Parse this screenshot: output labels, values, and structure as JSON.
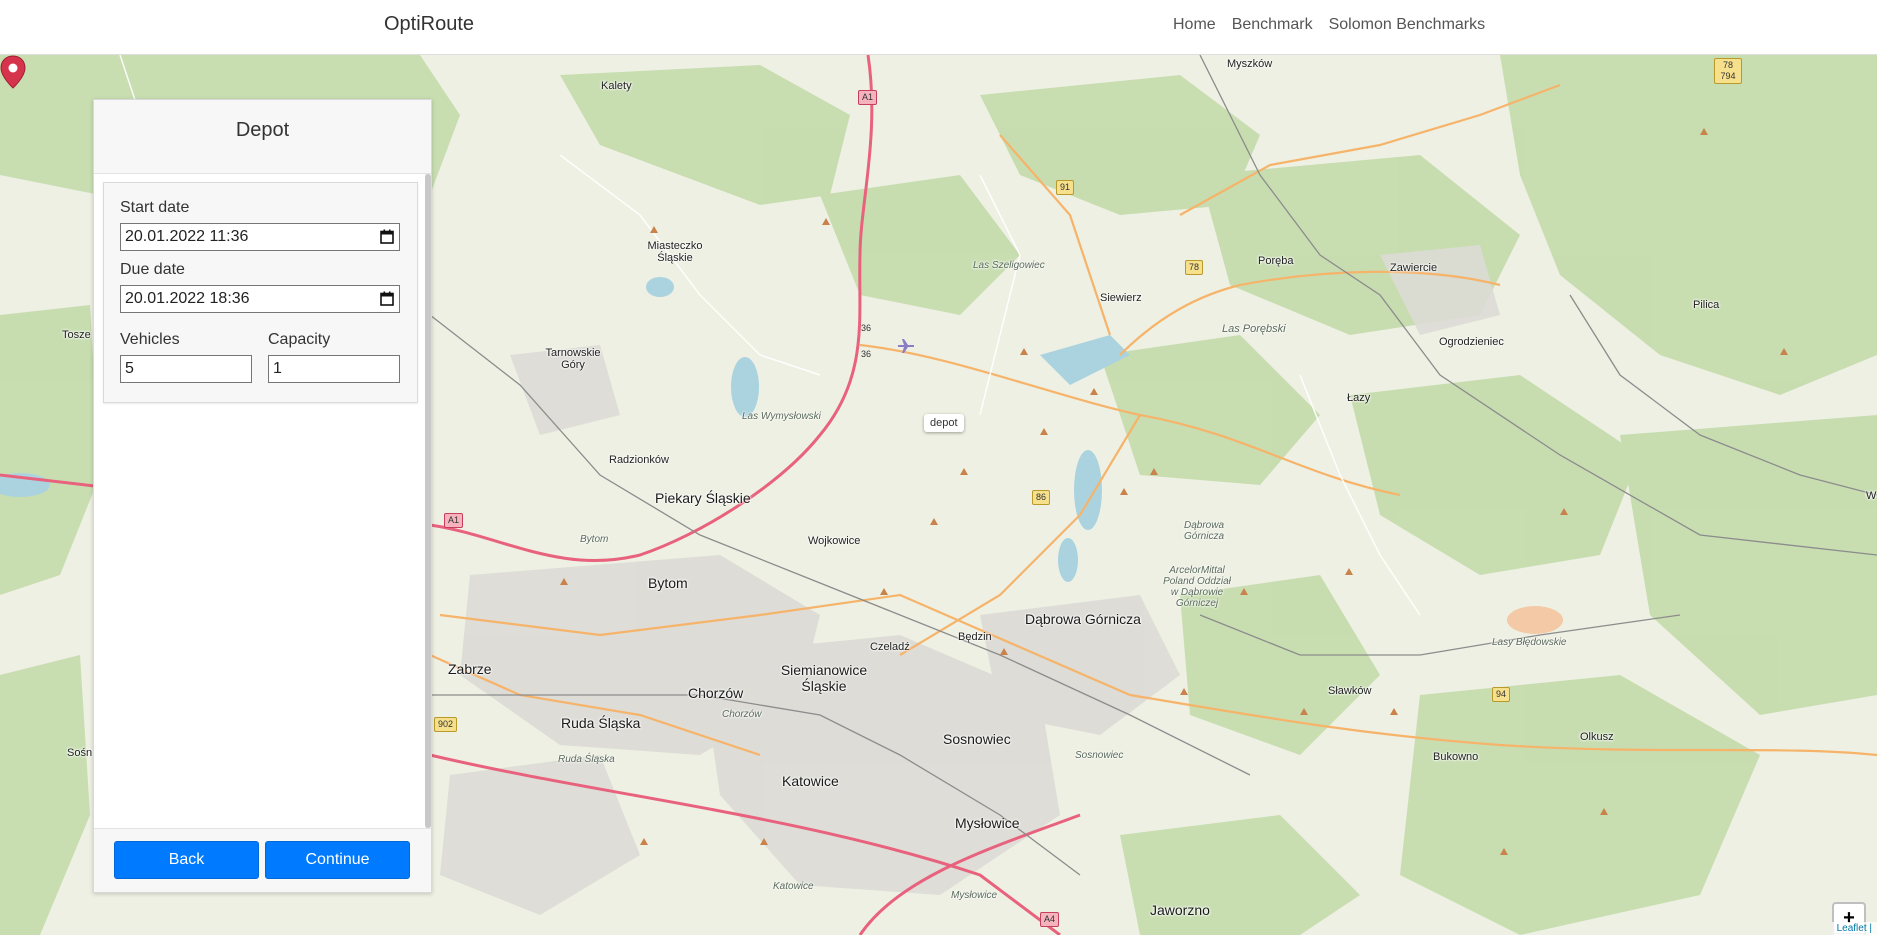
{
  "navbar": {
    "brand": "OptiRoute",
    "links": [
      "Home",
      "Benchmark",
      "Solomon Benchmarks"
    ]
  },
  "panel": {
    "title": "Depot",
    "start_date_label": "Start date",
    "start_date_value": "20.01.2022 11:36",
    "due_date_label": "Due date",
    "due_date_value": "20.01.2022 18:36",
    "vehicles_label": "Vehicles",
    "vehicles_value": "5",
    "capacity_label": "Capacity",
    "capacity_value": "1",
    "back_label": "Back",
    "continue_label": "Continue"
  },
  "map": {
    "marker_label": "depot",
    "zoom_in": "+",
    "zoom_out": "−",
    "attribution": "Leaflet |",
    "places": [
      "Myszków",
      "Kalety",
      "Miasteczko Śląskie",
      "Tarnowskie Góry",
      "Siewierz",
      "Poręba",
      "Zawiercie",
      "Pilica",
      "Ogrodzieniec",
      "Łazy",
      "Radzionków",
      "Piekary Śląskie",
      "Wojkowice",
      "Bytom",
      "Będzin",
      "Czeladź",
      "Dąbrowa Górnicza",
      "Zabrze",
      "Siemianowice Śląskie",
      "Chorzów",
      "Ruda Śląska",
      "Katowice",
      "Sosnowiec",
      "Mysłowice",
      "Jaworzno",
      "Sławków",
      "Bukowno",
      "Olkusz",
      "Tosze",
      "Sośn",
      "W"
    ],
    "italic_places": [
      "Las Szeligowiec",
      "Las Porębski",
      "Las Wymysłowski",
      "Dąbrowa Górnicza",
      "ArcelorMittal Poland Oddział w Dąbrowie Górniczej",
      "Bytom",
      "Chorzów",
      "Ruda Śląska",
      "Sosnowiec",
      "Katowice",
      "Mysłowice",
      "Lasy Błędowskie"
    ],
    "shields": [
      "A1",
      "A1",
      "91",
      "78",
      "86",
      "36",
      "36",
      "78 794",
      "902",
      "94",
      "A4"
    ]
  }
}
